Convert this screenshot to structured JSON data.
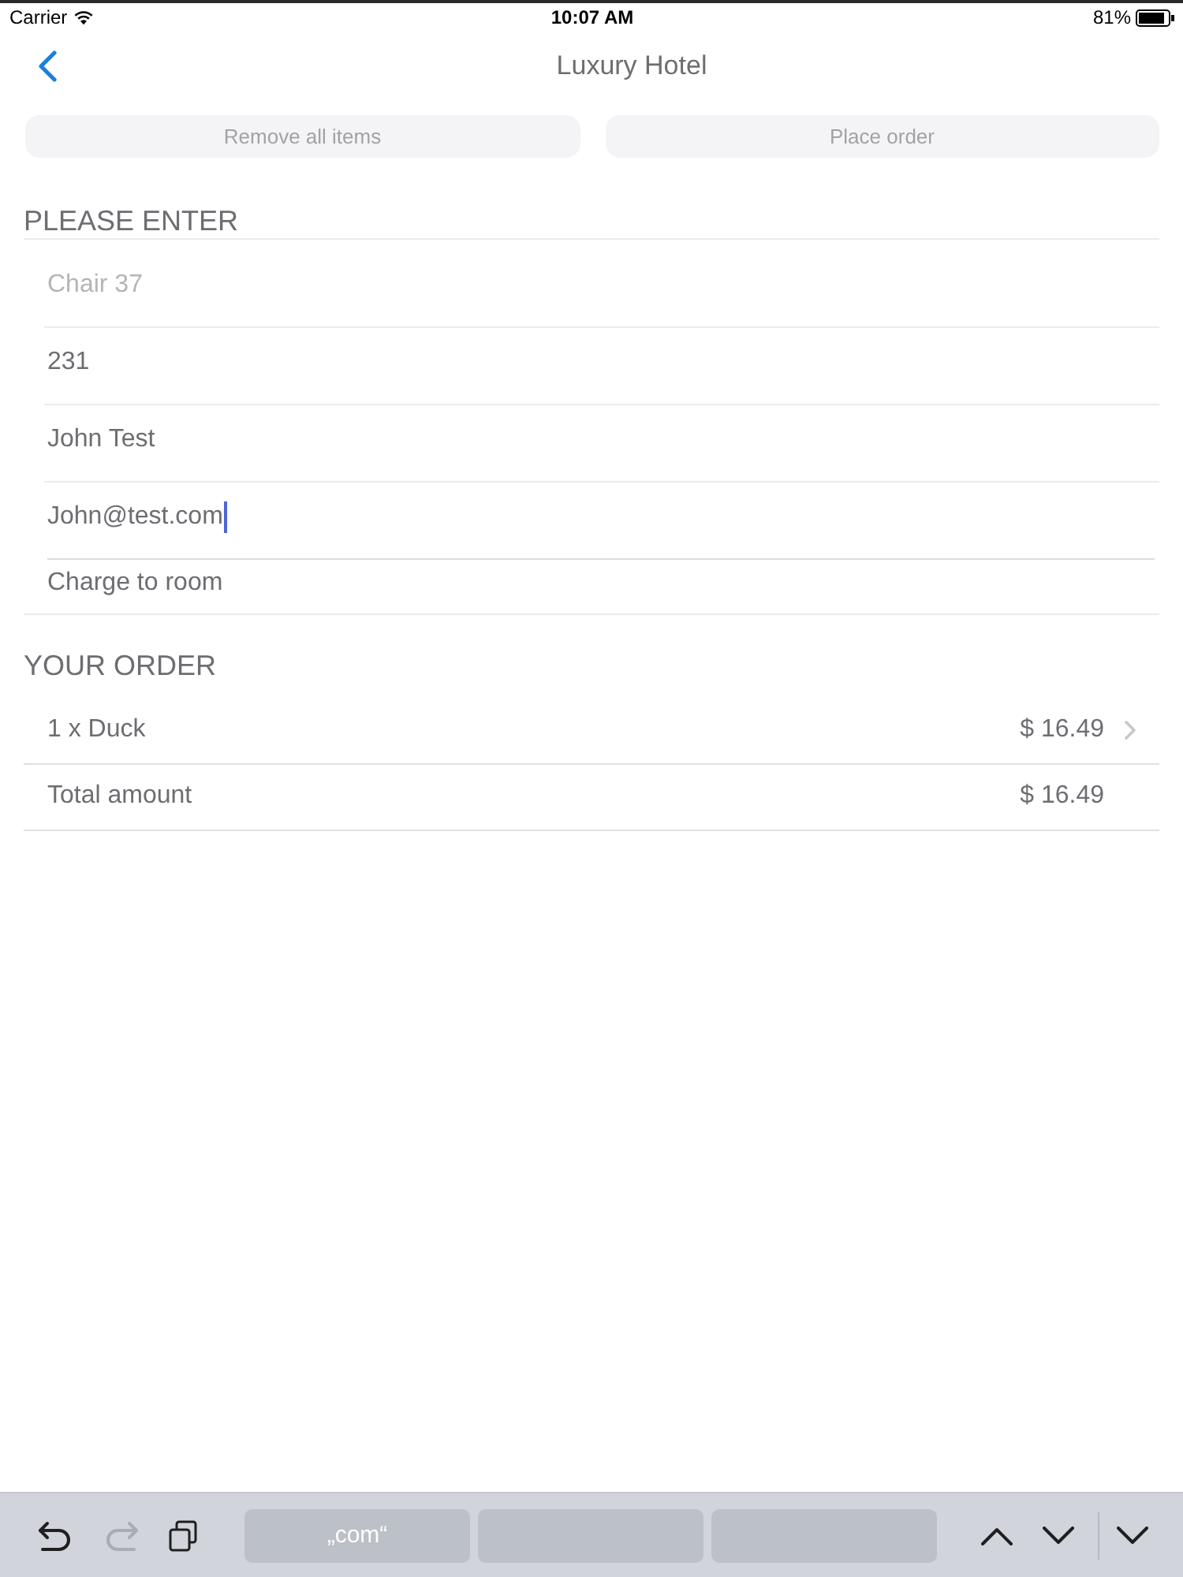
{
  "status_bar": {
    "carrier": "Carrier",
    "time": "10:07 AM",
    "battery": "81%"
  },
  "nav_bar": {
    "title": "Luxury Hotel"
  },
  "actions": [
    {
      "label": "Remove all items"
    },
    {
      "label": "Place order"
    }
  ],
  "entry": {
    "title": "PLEASE ENTER",
    "fields": [
      {
        "placeholder": "Chair 37",
        "focused": false
      },
      {
        "value": "231",
        "focused": false
      },
      {
        "value": "John Test",
        "focused": false
      },
      {
        "value": "John@test.com",
        "focused": true
      }
    ],
    "payment": {
      "label": "Charge to room"
    }
  },
  "order": {
    "title": "YOUR ORDER",
    "rows": [
      {
        "kind": "item",
        "label": "1 x Duck",
        "amount": "$ 16.49"
      },
      {
        "kind": "total",
        "label": "Total amount",
        "amount": "$ 16.49"
      }
    ]
  },
  "keyboard_bar": {
    "tools": [
      {
        "kind": "undo",
        "disabled": false
      },
      {
        "kind": "redo",
        "disabled": true
      },
      {
        "kind": "paste",
        "disabled": false
      }
    ],
    "suggestions": [
      "„com“"
    ]
  }
}
